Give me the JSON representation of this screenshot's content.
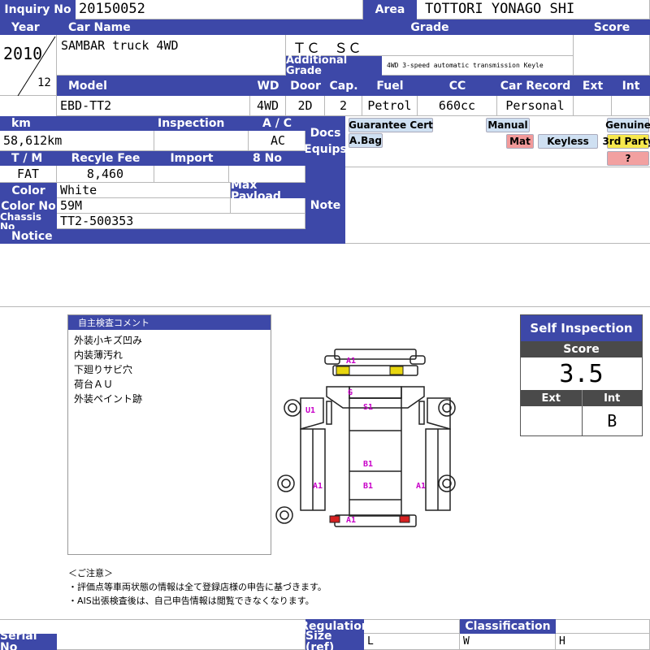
{
  "labels": {
    "inquiry_no": "Inquiry No",
    "area": "Area",
    "year": "Year",
    "car_name": "Car Name",
    "grade": "Grade",
    "score": "Score",
    "additional_grade": "Additional Grade",
    "model": "Model",
    "wd": "WD",
    "door": "Door",
    "cap": "Cap.",
    "fuel": "Fuel",
    "cc": "CC",
    "car_record": "Car Record",
    "ext": "Ext",
    "int": "Int",
    "km": "km",
    "inspection": "Inspection",
    "ac": "A / C",
    "docs_equips": "Docs Equips",
    "tm": "T / M",
    "recycle_fee": "Recyle Fee",
    "import": "Import",
    "eight_no": "8 No",
    "color": "Color",
    "max_payload": "Max Payload",
    "color_no": "Color No",
    "note": "Note",
    "chassis_no": "Chassis No",
    "notice": "Notice",
    "regulation": "Regulation",
    "classification": "Classification",
    "size_ref": "Size (ref)",
    "serial_no": "Serial No",
    "size_l": "L",
    "size_w": "W",
    "size_h": "H"
  },
  "values": {
    "inquiry_no": "20150052",
    "area": "TOTTORI YONAGO SHI",
    "year": "2010",
    "month": "12",
    "car_name": "SAMBAR truck 4WD",
    "grade": "ＴＣ　ＳＣ",
    "additional_grade": "4WD 3-speed automatic transmission Keyle",
    "model": "EBD-TT2",
    "wd": "4WD",
    "door": "2D",
    "cap": "2",
    "fuel": "Petrol",
    "cc": "660cc",
    "car_record": "Personal",
    "km": "58,612km",
    "ac": "AC",
    "tm": "FAT",
    "recycle_fee": "8,460",
    "color": "White",
    "color_no": "59M",
    "chassis_no": "TT2-500353"
  },
  "equip_tags": {
    "guarantee": "Guarantee Cert",
    "manual": "Manual",
    "genuine": "Genuine",
    "abag": "A.Bag",
    "mat": "Mat",
    "keyless": "Keyless",
    "third_party": "3rd Party",
    "question": "?"
  },
  "colors": {
    "header": "#3d48a8",
    "self_header": "#3d48a8",
    "score_header": "#4a4a4a",
    "mark_text": "#c800c8"
  },
  "comments": {
    "title": "自主検査コメント",
    "lines": [
      "外装小キズ凹み",
      "内装薄汚れ",
      "下廻りサビ穴",
      "荷台ＡＵ",
      "外装ペイント跡"
    ]
  },
  "self_inspection": {
    "title": "Self Inspection",
    "score_label": "Score",
    "score": "3.5",
    "ext_label": "Ext",
    "int_label": "Int",
    "ext": "",
    "int": "B"
  },
  "diagram_marks": {
    "front_a1": "A1",
    "g": "G",
    "s1": "S1",
    "u1": "U1",
    "bed_b1_top": "B1",
    "bed_b1_bottom": "B1",
    "left_a1": "A1",
    "right_a1": "A1",
    "rear_a1": "A1"
  },
  "caution": {
    "title": "＜ご注意＞",
    "lines": [
      "・評価点等車両状態の情報は全て登録店様の申告に基づきます。",
      "・AIS出張検査後は、自己申告情報は閲覧できなくなります。"
    ]
  }
}
